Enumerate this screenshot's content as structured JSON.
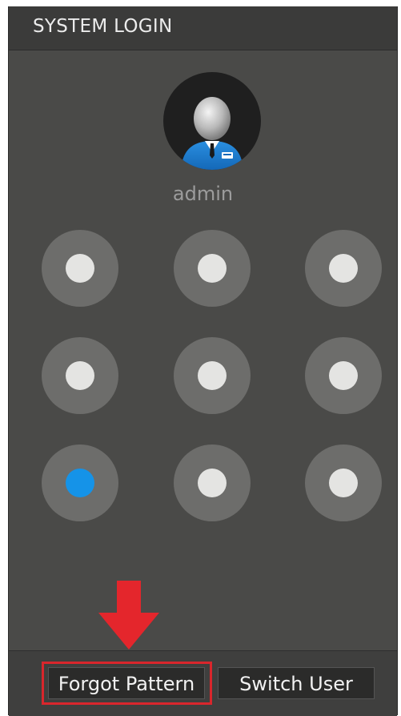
{
  "window": {
    "title": "SYSTEM LOGIN"
  },
  "user": {
    "name": "admin",
    "avatar_icon": "user-avatar-icon"
  },
  "pattern": {
    "nodes": [
      {
        "id": 1,
        "state": "idle"
      },
      {
        "id": 2,
        "state": "idle"
      },
      {
        "id": 3,
        "state": "idle"
      },
      {
        "id": 4,
        "state": "idle"
      },
      {
        "id": 5,
        "state": "idle"
      },
      {
        "id": 6,
        "state": "idle"
      },
      {
        "id": 7,
        "state": "active"
      },
      {
        "id": 8,
        "state": "idle"
      },
      {
        "id": 9,
        "state": "idle"
      }
    ],
    "active_color": "#1593e8",
    "idle_color": "#e4e4e2"
  },
  "footer": {
    "forgot_label": "Forgot Pattern",
    "switch_label": "Switch User"
  },
  "annotation": {
    "color": "#d9262c",
    "icon": "down-arrow-icon"
  }
}
